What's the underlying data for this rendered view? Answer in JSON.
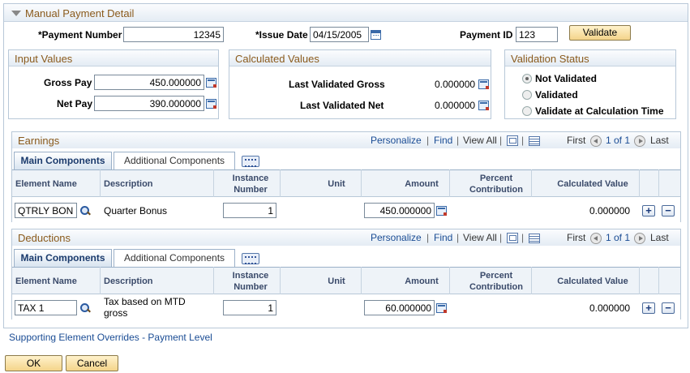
{
  "page": {
    "section_title": "Manual Payment Detail"
  },
  "header": {
    "payment_number_label": "*Payment Number",
    "payment_number_value": "12345",
    "issue_date_label": "*Issue Date",
    "issue_date_value": "04/15/2005",
    "payment_id_label": "Payment ID",
    "payment_id_value": "123",
    "validate_label": "Validate"
  },
  "input_values": {
    "title": "Input Values",
    "gross_pay_label": "Gross Pay",
    "gross_pay_value": "450.000000",
    "net_pay_label": "Net Pay",
    "net_pay_value": "390.000000"
  },
  "calculated_values": {
    "title": "Calculated Values",
    "last_gross_label": "Last Validated Gross",
    "last_gross_value": "0.000000",
    "last_net_label": "Last Validated Net",
    "last_net_value": "0.000000"
  },
  "validation_status": {
    "title": "Validation Status",
    "options": [
      "Not Validated",
      "Validated",
      "Validate at Calculation Time"
    ],
    "selected": "Not Validated"
  },
  "earnings": {
    "title": "Earnings",
    "nav": {
      "personalize": "Personalize",
      "find": "Find",
      "view_all": "View All",
      "first": "First",
      "count": "1 of 1",
      "last": "Last"
    },
    "tabs": [
      "Main Components",
      "Additional Components"
    ],
    "columns": {
      "element_name": "Element Name",
      "description": "Description",
      "instance_number": "Instance Number",
      "unit": "Unit",
      "amount": "Amount",
      "percent_contribution": "Percent Contribution",
      "calculated_value": "Calculated Value"
    },
    "row": {
      "element_name": "QTRLY BONUS",
      "description": "Quarter Bonus",
      "instance_number": "1",
      "amount": "450.000000",
      "calculated_value": "0.000000"
    }
  },
  "deductions": {
    "title": "Deductions",
    "nav": {
      "personalize": "Personalize",
      "find": "Find",
      "view_all": "View All",
      "first": "First",
      "count": "1 of 1",
      "last": "Last"
    },
    "tabs": [
      "Main Components",
      "Additional Components"
    ],
    "columns": {
      "element_name": "Element Name",
      "description": "Description",
      "instance_number": "Instance Number",
      "unit": "Unit",
      "amount": "Amount",
      "percent_contribution": "Percent Contribution",
      "calculated_value": "Calculated Value"
    },
    "row": {
      "element_name": "TAX 1",
      "description": "Tax based on MTD gross",
      "instance_number": "1",
      "amount": "60.000000",
      "calculated_value": "0.000000"
    }
  },
  "footer": {
    "supporting_link": "Supporting Element Overrides - Payment Level",
    "ok_label": "OK",
    "cancel_label": "Cancel"
  }
}
